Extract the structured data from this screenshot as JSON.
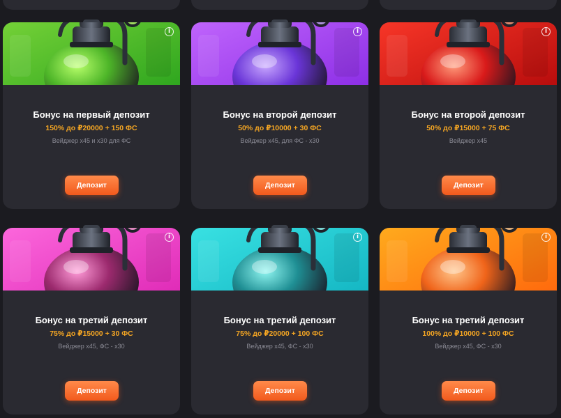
{
  "cards": [
    {
      "title": "Бонус на первый депозит",
      "offer": "150% до ₽20000 + 150 ФС",
      "wager": "Вейджер х45 и х30 для ФС",
      "button": "Депозит",
      "bg_from": "#7dd63a",
      "bg_to": "#2fa61f",
      "tank": "#4db528",
      "tank_light": "#b8ff6a",
      "icon": "green-gas-tank-icon"
    },
    {
      "title": "Бонус на второй депозит",
      "offer": "50% до ₽10000 + 30 ФС",
      "wager": "Вейджер х45, для ФС - х30",
      "button": "Депозит",
      "bg_from": "#c66bff",
      "bg_to": "#8d2fe6",
      "tank": "#6a35d8",
      "tank_light": "#c8a6ff",
      "icon": "purple-gas-tank-icon"
    },
    {
      "title": "Бонус на второй депозит",
      "offer": "50% до ₽15000 + 75 ФС",
      "wager": "Вейджер х45",
      "button": "Депозит",
      "bg_from": "#ff3b2b",
      "bg_to": "#b80d0d",
      "tank": "#d91a1a",
      "tank_light": "#ff9a7a",
      "icon": "red-gas-tank-icon"
    },
    {
      "title": "Бонус на третий депозит",
      "offer": "75% до ₽15000 + 30 ФС",
      "wager": "Вейджер х45, ФС - х30",
      "button": "Депозит",
      "bg_from": "#ff6ee0",
      "bg_to": "#e02cb8",
      "tank": "#9c2a6e",
      "tank_light": "#ff9bd8",
      "icon": "pink-gas-tank-icon"
    },
    {
      "title": "Бонус на третий депозит",
      "offer": "75% до ₽20000 + 100 ФС",
      "wager": "Вейджер х45, ФС - х30",
      "button": "Депозит",
      "bg_from": "#3de6e6",
      "bg_to": "#15b7c4",
      "tank": "#1f8f94",
      "tank_light": "#8ff5f0",
      "icon": "teal-gas-tank-icon"
    },
    {
      "title": "Бонус на третий депозит",
      "offer": "100% до ₽10000 + 100 ФС",
      "wager": "Вейджер х45, ФС - х30",
      "button": "Депозит",
      "bg_from": "#ffb21f",
      "bg_to": "#ff6a0d",
      "tank": "#f0641a",
      "tank_light": "#ffc58a",
      "icon": "orange-gas-tank-icon"
    }
  ],
  "colors": {
    "page_bg": "#1b1b20",
    "card_bg": "#2a2a31",
    "accent": "#f5a623",
    "button": "#f25a1d",
    "muted_text": "#8a8a94"
  },
  "info_icon": "info-icon"
}
